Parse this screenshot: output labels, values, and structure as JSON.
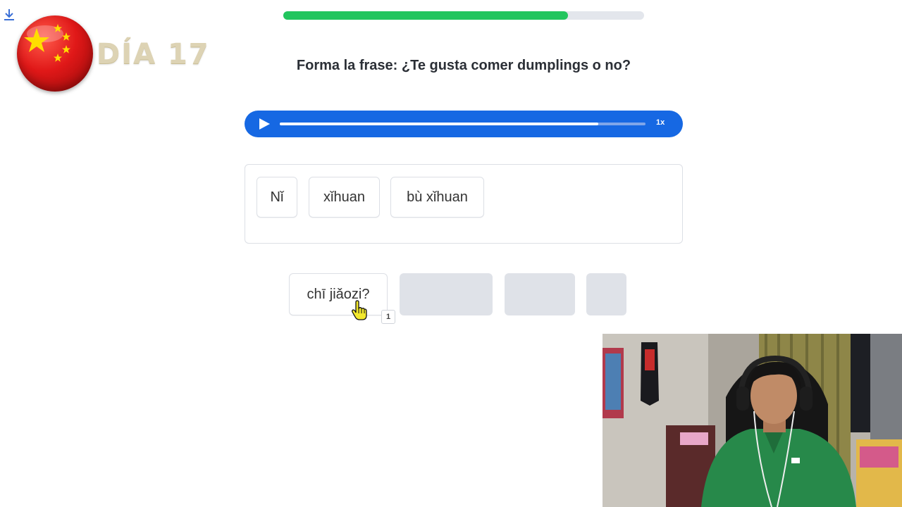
{
  "overlay": {
    "day_label": "DÍA 17",
    "flag_icon": "china-flag-icon",
    "download_icon": "download-icon"
  },
  "lesson": {
    "progress": 0.79,
    "prompt": "Forma la frase: ¿Te gusta comer dumplings o no?",
    "audio": {
      "played": 0.87,
      "speed_label": "1x"
    },
    "answer_chips": [
      "Nǐ",
      "xǐhuan",
      "bù xǐhuan"
    ],
    "word_bank": {
      "chip_label": "chī jiǎozi?",
      "key_hint": "1",
      "empty_slots": 3
    }
  },
  "colors": {
    "progress": "#22c55e",
    "audio_bar": "#1668e3",
    "slot": "#dfe2e8",
    "flag_red": "#e01818",
    "flag_star": "#ffde00"
  }
}
